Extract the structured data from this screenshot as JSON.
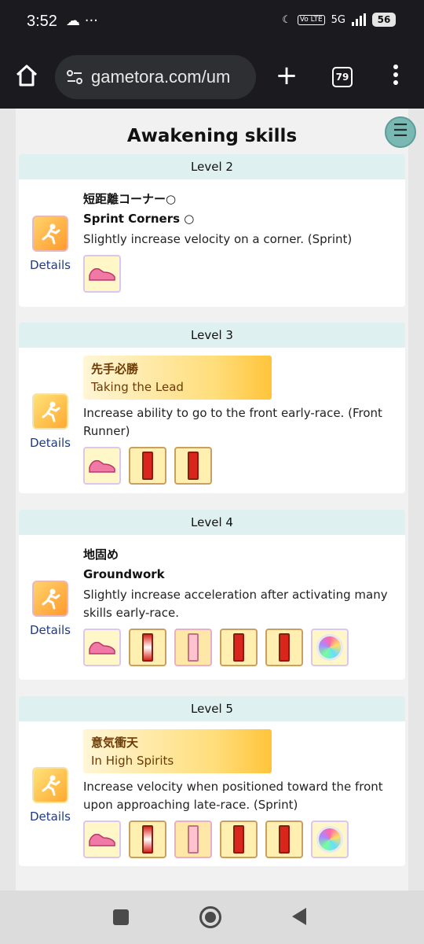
{
  "status_bar": {
    "time": "3:52",
    "left_icons": "☁ ···",
    "volte": "Vo LTE",
    "network": "5G",
    "battery": "56"
  },
  "browser": {
    "url": "gametora.com/um",
    "tab_count": "79"
  },
  "page": {
    "title": "Awakening skills",
    "fab_icon": "☰",
    "details_label": "Details"
  },
  "levels": [
    {
      "header": "Level 2",
      "skill_jp": "短距離コーナー○",
      "skill_en": "Sprint Corners ○",
      "description": "Slightly increase velocity on a corner. (Sprint)",
      "gold": false,
      "materials": [
        "shoe"
      ]
    },
    {
      "header": "Level 3",
      "skill_jp": "先手必勝",
      "skill_en": "Taking the Lead",
      "description": "Increase ability to go to the front early-race. (Front Runner)",
      "gold": true,
      "materials": [
        "shoe",
        "red-scroll",
        "red-scroll"
      ]
    },
    {
      "header": "Level 4",
      "skill_jp": "地固め",
      "skill_en": "Groundwork",
      "description": "Slightly increase acceleration after activating many skills early-race.",
      "gold": false,
      "materials": [
        "shoe",
        "red-white-scroll",
        "pink-scroll",
        "red-scroll",
        "red-scroll",
        "gem"
      ]
    },
    {
      "header": "Level 5",
      "skill_jp": "意気衝天",
      "skill_en": "In High Spirits",
      "description": "Increase velocity when positioned toward the front upon approaching late-race. (Sprint)",
      "gold": true,
      "materials": [
        "shoe",
        "red-white-scroll",
        "pink-scroll",
        "red-scroll",
        "red-scroll",
        "gem"
      ]
    }
  ],
  "colors": {
    "level_header_bg": "#dff0f1",
    "details_link": "#1e3a8a",
    "gold_text": "#6b3a05",
    "fab": "#7ab8b4"
  }
}
